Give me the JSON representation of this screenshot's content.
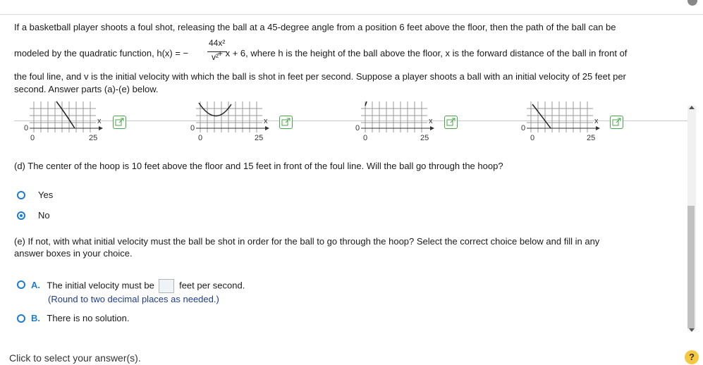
{
  "question": {
    "line1": "If a basketball player shoots a foul shot, releasing the ball at a 45-degree angle from a position 6 feet above the floor, then the path of the ball can be",
    "line2_prefix": "modeled by the quadratic function, h(x) = −",
    "numerator": "44x²",
    "denominator": "v²",
    "line2_suffix": "+ x + 6, where h is the height of the ball above the floor, x is the forward distance of the ball in front of",
    "line3": "the foul line, and v is the initial velocity with which the ball is shot in feet per second.  Suppose a player shoots a ball with an initial velocity of 25 feet per",
    "line4": "second.  Answer parts (a)-(e) below."
  },
  "graphs": [
    {
      "y0": "0",
      "x0": "0",
      "x25": "25",
      "xlabel": "x"
    },
    {
      "y0": "0",
      "x0": "0",
      "x25": "25",
      "xlabel": "x"
    },
    {
      "y0": "0",
      "x0": "0",
      "x25": "25",
      "xlabel": "x"
    },
    {
      "y0": "0",
      "x0": "0",
      "x25": "25",
      "xlabel": "x"
    }
  ],
  "part_d": {
    "prompt": "(d) The center of the hoop is 10 feet above the floor and 15 feet in front of the foul line.  Will the ball go through the hoop?",
    "options": [
      "Yes",
      "No"
    ],
    "selected": "No"
  },
  "part_e": {
    "prompt_line1": "(e) If not, with what initial velocity must the ball be shot in order for the ball to go through the hoop? Select the correct choice below and fill in any",
    "prompt_line2": "answer boxes in your choice.",
    "optA_letter": "A.",
    "optA_before": "The initial velocity must be",
    "optA_after": "feet per second.",
    "optA_note": "(Round to two decimal places as needed.)",
    "optB_letter": "B.",
    "optB_text": "There is no solution."
  },
  "footer": {
    "text": "Click to select your answer(s).",
    "help": "?"
  }
}
